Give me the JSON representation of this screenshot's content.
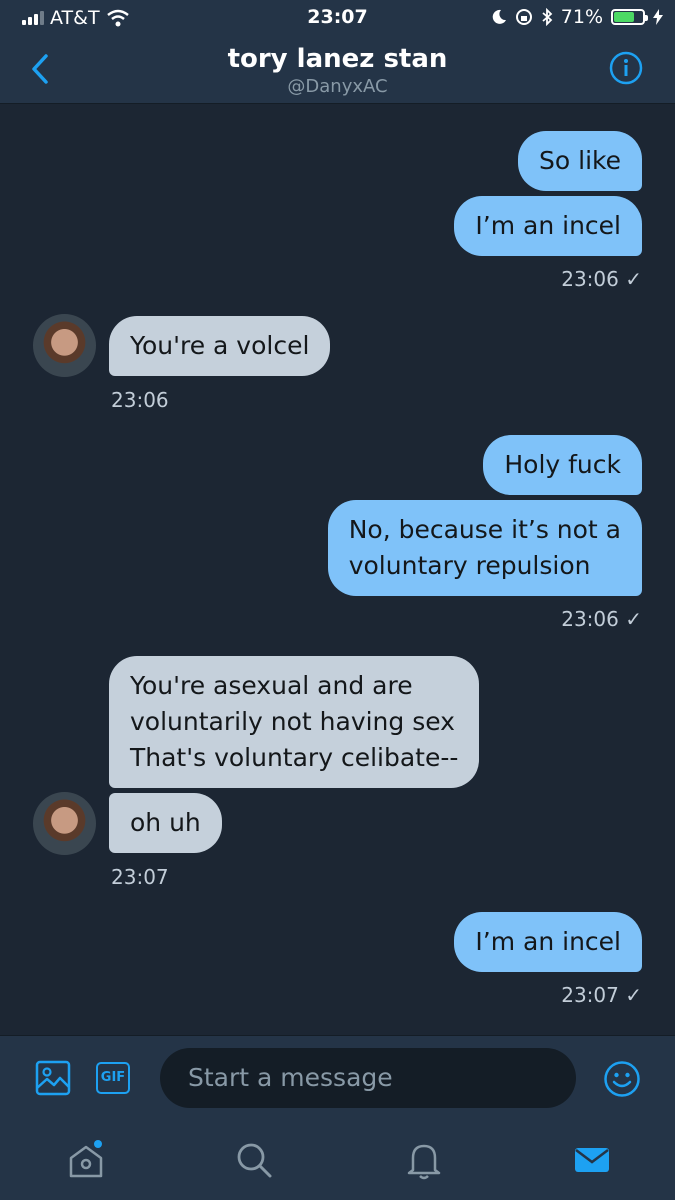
{
  "status_bar": {
    "carrier": "AT&T",
    "time": "23:07",
    "battery_percent": "71%",
    "battery_level": 0.71
  },
  "header": {
    "name": "tory lanez stan",
    "handle": "@DanyxAC"
  },
  "messages": [
    {
      "side": "out",
      "text": "So like"
    },
    {
      "side": "out",
      "text": "I’m an incel"
    },
    {
      "side": "out_meta",
      "text": "23:06 ✓"
    },
    {
      "side": "in",
      "text": "You're a volcel"
    },
    {
      "side": "in_meta",
      "text": "23:06"
    },
    {
      "side": "out",
      "text": "Holy fuck"
    },
    {
      "side": "out",
      "lines": [
        "No, because it’s not a",
        "voluntary repulsion"
      ]
    },
    {
      "side": "out_meta",
      "text": "23:06 ✓"
    },
    {
      "side": "in",
      "lines": [
        "You're asexual and are",
        "voluntarily not having sex",
        "That's voluntary celibate--"
      ]
    },
    {
      "side": "in",
      "text": "oh uh"
    },
    {
      "side": "in_meta",
      "text": "23:07"
    },
    {
      "side": "out",
      "text": "I’m an incel"
    },
    {
      "side": "out_meta",
      "text": "23:07 ✓"
    }
  ],
  "composer": {
    "placeholder": "Start a message",
    "gif_label": "GIF"
  },
  "icons": {
    "back": "chevron-left-icon",
    "info": "info-icon",
    "image": "image-icon",
    "gif": "gif-icon",
    "emoji": "emoji-icon",
    "home": "home-icon",
    "search": "search-icon",
    "notifications": "bell-icon",
    "messages": "mail-icon"
  },
  "colors": {
    "accent": "#1da1f2",
    "outgoing_bubble": "#7fc2f9",
    "incoming_bubble": "#c5d0db",
    "background": "#1c2633",
    "bar": "#243447"
  }
}
